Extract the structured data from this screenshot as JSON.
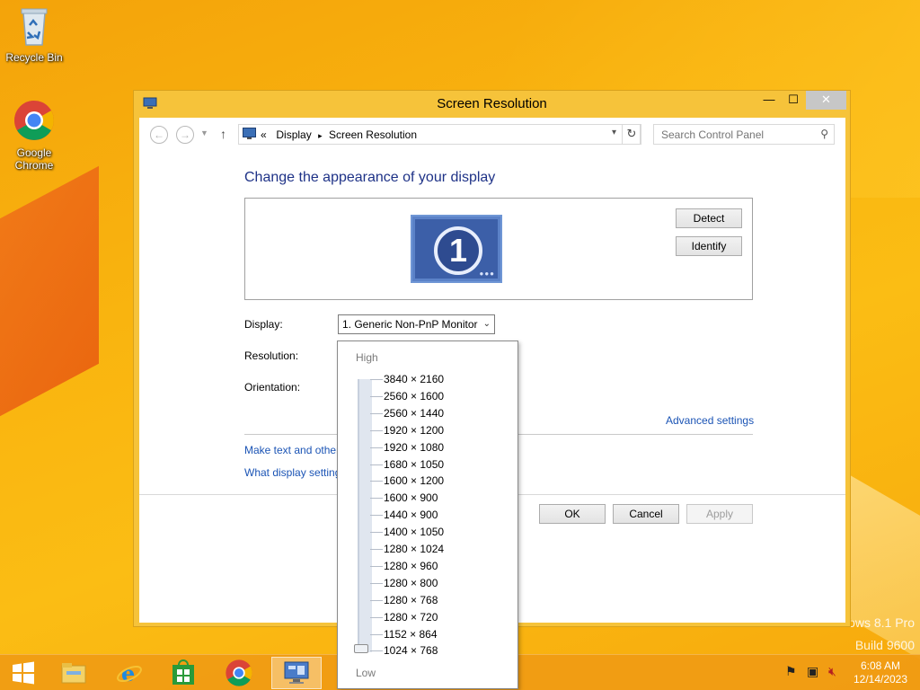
{
  "desktop": {
    "icons": [
      {
        "name": "recycle-bin",
        "label": "Recycle Bin"
      },
      {
        "name": "google-chrome",
        "label": "Google Chrome"
      }
    ],
    "watermark": {
      "line1": "ows 8.1 Pro",
      "line2": "Build 9600"
    }
  },
  "window": {
    "title": "Screen Resolution",
    "controls": {
      "minimize": "—",
      "maximize": "☐",
      "close": "✕"
    },
    "address": {
      "chevrons": "«",
      "crumb1": "Display",
      "arrow": "▸",
      "crumb2": "Screen Resolution"
    },
    "search_placeholder": "Search Control Panel",
    "heading": "Change the appearance of your display",
    "monitor_number": "1",
    "buttons": {
      "detect": "Detect",
      "identify": "Identify",
      "ok": "OK",
      "cancel": "Cancel",
      "apply": "Apply"
    },
    "labels": {
      "display": "Display:",
      "resolution": "Resolution:",
      "orientation": "Orientation:"
    },
    "display_value": "1. Generic Non-PnP Monitor",
    "links": {
      "advanced": "Advanced settings",
      "make_text": "Make text and other",
      "what_display": "What display setting"
    }
  },
  "resolution_dropdown": {
    "high_label": "High",
    "low_label": "Low",
    "options": [
      "3840 × 2160",
      "2560 × 1600",
      "2560 × 1440",
      "1920 × 1200",
      "1920 × 1080",
      "1680 × 1050",
      "1600 × 1200",
      "1600 × 900",
      "1440 × 900",
      "1400 × 1050",
      "1280 × 1024",
      "1280 × 960",
      "1280 × 800",
      "1280 × 768",
      "1280 × 720",
      "1152 × 864",
      "1024 × 768"
    ],
    "selected": "1024 × 768"
  },
  "taskbar": {
    "items": [
      "start-button",
      "file-explorer",
      "internet-explorer",
      "store",
      "chrome",
      "control-panel"
    ],
    "time": "6:08 AM",
    "date": "12/14/2023"
  },
  "colors": {
    "accent": "#f7a90c",
    "link": "#1b54b5",
    "heading": "#1e3287"
  }
}
